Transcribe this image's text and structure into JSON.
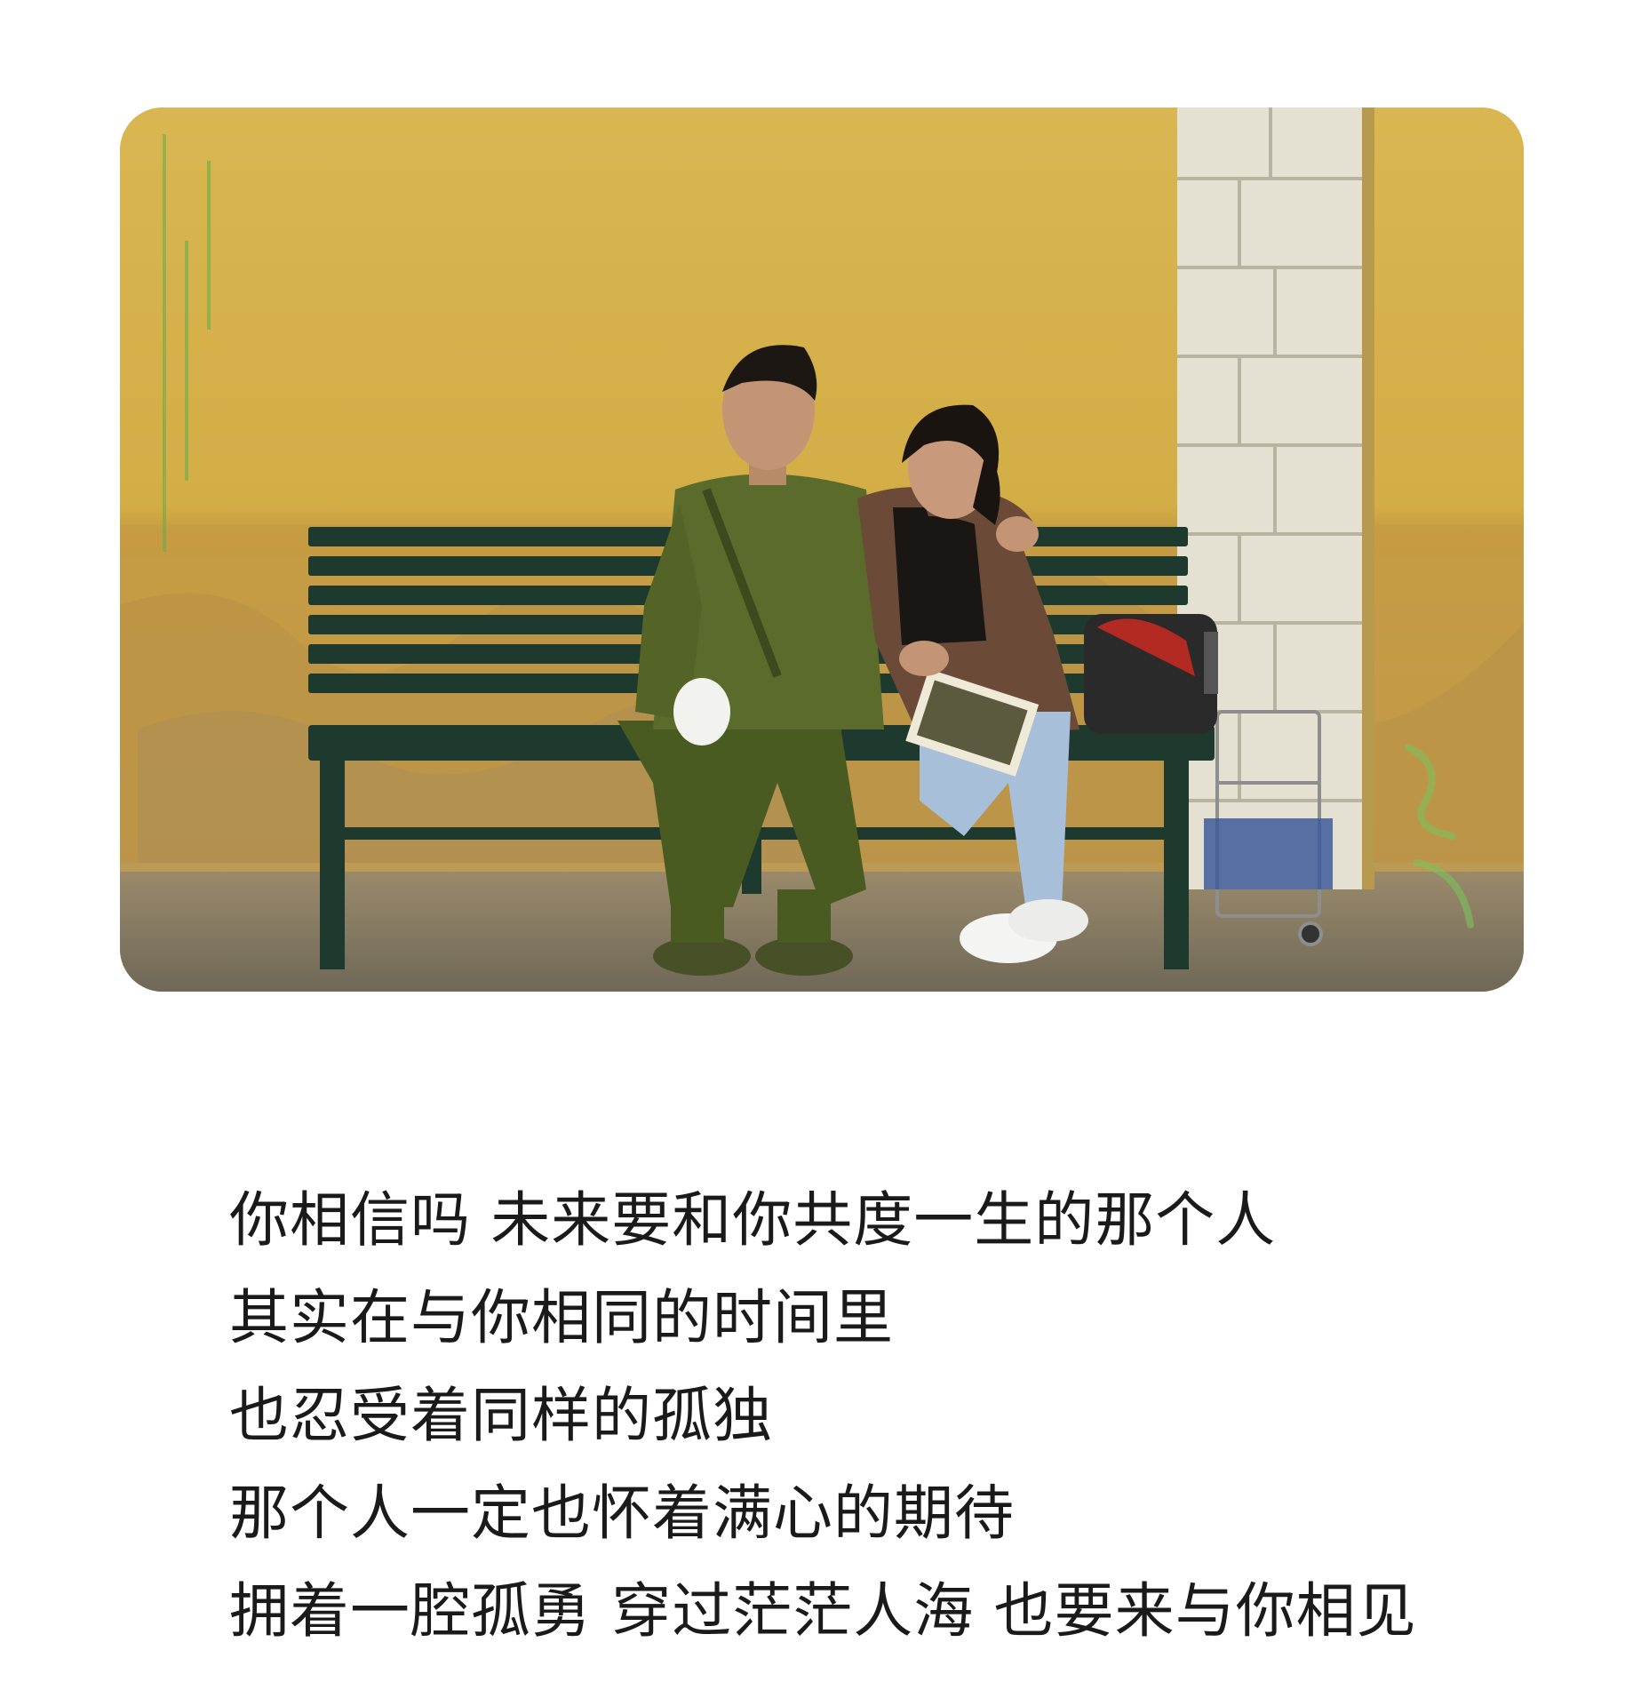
{
  "photo": {
    "description_icon": "film-still-couple-on-bench",
    "colors": {
      "wall_yellow": "#d6b04a",
      "wall_lower": "#c89a3a",
      "pillar": "#e6e2d6",
      "bench": "#1f3a30",
      "ground": "#8a8270",
      "uniform": "#5a6a2a",
      "jacket": "#6e4a36",
      "jeans": "#a9bfd8"
    }
  },
  "caption": {
    "lines": [
      "你相信吗 未来要和你共度一生的那个人",
      "其实在与你相同的时间里",
      "也忍受着同样的孤独",
      "那个人一定也怀着满心的期待",
      "拥着一腔孤勇 穿过茫茫人海 也要来与你相见"
    ]
  }
}
